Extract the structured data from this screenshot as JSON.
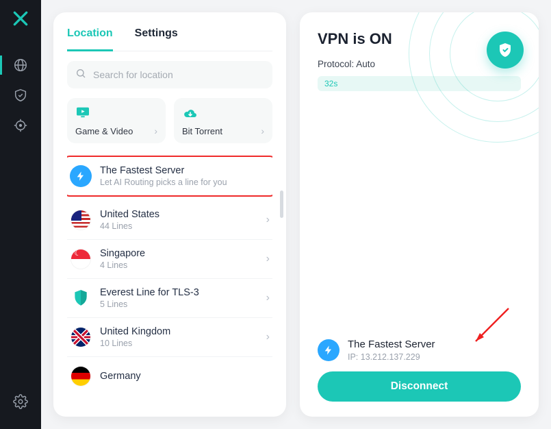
{
  "sidebar": {
    "logo": "X"
  },
  "tabs": {
    "location": "Location",
    "settings": "Settings"
  },
  "search": {
    "placeholder": "Search for location"
  },
  "quick": {
    "game_video": "Game & Video",
    "bit_torrent": "Bit Torrent"
  },
  "fastest": {
    "title": "The Fastest Server",
    "subtitle": "Let AI Routing picks a line for you"
  },
  "servers": [
    {
      "name": "United States",
      "lines": "44 Lines"
    },
    {
      "name": "Singapore",
      "lines": "4 Lines"
    },
    {
      "name": "Everest Line for TLS-3",
      "lines": "5 Lines"
    },
    {
      "name": "United Kingdom",
      "lines": "10 Lines"
    },
    {
      "name": "Germany",
      "lines": ""
    }
  ],
  "status": {
    "title": "VPN is ON",
    "protocol": "Protocol: Auto",
    "elapsed": "32s"
  },
  "connection": {
    "server": "The Fastest Server",
    "ip": "IP: 13.212.137.229"
  },
  "disconnect_label": "Disconnect"
}
